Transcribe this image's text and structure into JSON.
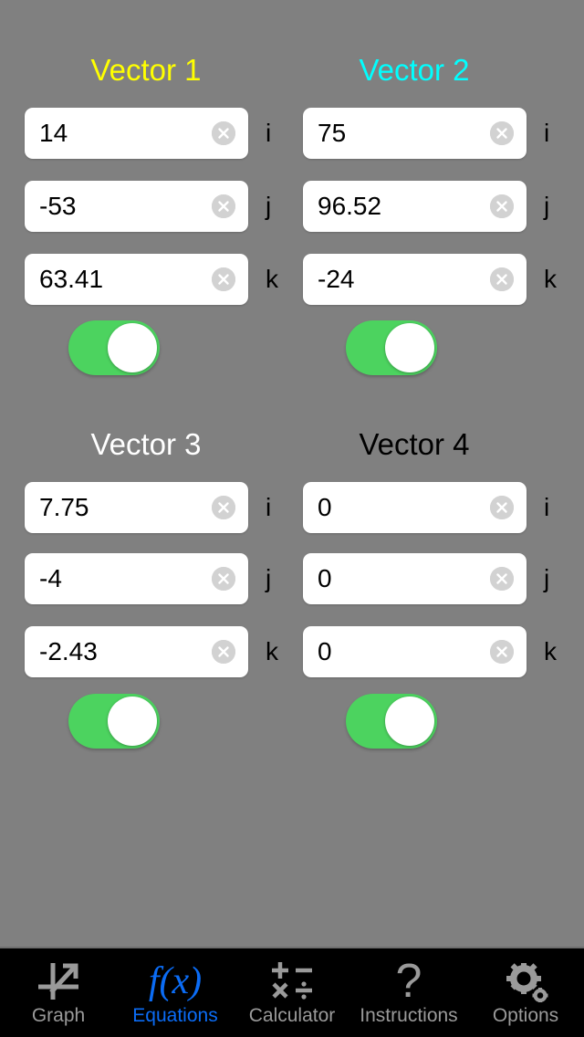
{
  "screen": {
    "background_color": "#808080",
    "app_section": "Equations"
  },
  "vectors": [
    {
      "title": "Vector 1",
      "color": "#FFFF00",
      "components": [
        {
          "unit": "i",
          "value": "14"
        },
        {
          "unit": "j",
          "value": "-53"
        },
        {
          "unit": "k",
          "value": "63.41"
        }
      ],
      "enabled": true,
      "toggle_state": "on"
    },
    {
      "title": "Vector 2",
      "color": "#00FFFF",
      "components": [
        {
          "unit": "i",
          "value": "75"
        },
        {
          "unit": "j",
          "value": "96.52"
        },
        {
          "unit": "k",
          "value": "-24"
        }
      ],
      "enabled": true,
      "toggle_state": "on"
    },
    {
      "title": "Vector 3",
      "color": "#FFFFFF",
      "components": [
        {
          "unit": "i",
          "value": "7.75"
        },
        {
          "unit": "j",
          "value": "-4"
        },
        {
          "unit": "k",
          "value": "-2.43"
        }
      ],
      "enabled": true,
      "toggle_state": "on"
    },
    {
      "title": "Vector 4",
      "color": "#000000",
      "components": [
        {
          "unit": "i",
          "value": "0"
        },
        {
          "unit": "j",
          "value": "0"
        },
        {
          "unit": "k",
          "value": "0"
        }
      ],
      "enabled": true,
      "toggle_state": "on"
    }
  ],
  "tabbar": {
    "active_color": "#0B6CF5",
    "inactive_color": "#9A9A9A",
    "background_color": "#000000",
    "tabs": [
      {
        "label": "Graph",
        "icon": "axes-arrow-icon",
        "active": false
      },
      {
        "label": "Equations",
        "icon": "fx-icon",
        "active": true
      },
      {
        "label": "Calculator",
        "icon": "operators-icon",
        "active": false
      },
      {
        "label": "Instructions",
        "icon": "question-mark-icon",
        "active": false
      },
      {
        "label": "Options",
        "icon": "gears-icon",
        "active": false
      }
    ]
  },
  "icons": {
    "clear": "clear-circle-x-icon",
    "calculator_symbols": [
      "+",
      "−",
      "×",
      "÷"
    ],
    "question": "?"
  }
}
